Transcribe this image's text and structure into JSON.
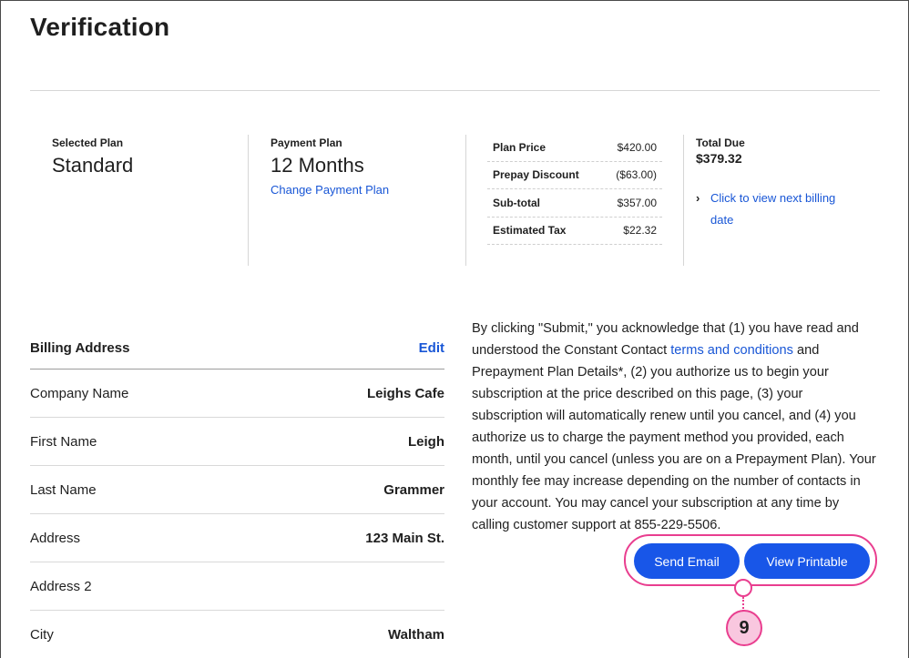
{
  "page": {
    "title": "Verification"
  },
  "summary": {
    "selected_plan": {
      "label": "Selected Plan",
      "value": "Standard"
    },
    "payment_plan": {
      "label": "Payment Plan",
      "value": "12 Months",
      "change_link": "Change Payment Plan"
    },
    "price_rows": [
      {
        "label": "Plan Price",
        "value": "$420.00"
      },
      {
        "label": "Prepay Discount",
        "value": "($63.00)"
      },
      {
        "label": "Sub-total",
        "value": "$357.00"
      },
      {
        "label": "Estimated Tax",
        "value": "$22.32"
      }
    ],
    "total_due": {
      "label": "Total Due",
      "value": "$379.32",
      "next_billing_link": "Click to view next billing date"
    }
  },
  "billing": {
    "header": {
      "label": "Billing Address",
      "edit": "Edit"
    },
    "rows": [
      {
        "label": "Company Name",
        "value": "Leighs Cafe"
      },
      {
        "label": "First Name",
        "value": "Leigh"
      },
      {
        "label": "Last Name",
        "value": "Grammer"
      },
      {
        "label": "Address",
        "value": "123 Main St."
      },
      {
        "label": "Address 2",
        "value": ""
      },
      {
        "label": "City",
        "value": "Waltham"
      }
    ]
  },
  "legal": {
    "part1": "By clicking \"Submit,\" you acknowledge that (1) you have read and understood the Constant Contact ",
    "terms_link": "terms and conditions",
    "part2": " and Prepayment Plan Details*, (2) you authorize us to begin your subscription at the price described on this page, (3) your subscription will automatically renew until you cancel, and (4) you authorize us to charge the payment method you provided, each month, until you cancel (unless you are on a Prepayment Plan). Your monthly fee may increase depending on the number of contacts in your account. You may cancel your subscription at any time by calling customer support at 855-229-5506."
  },
  "actions": {
    "send_email": "Send Email",
    "view_printable": "View Printable"
  },
  "callout": {
    "number": "9"
  },
  "colors": {
    "accent_blue": "#1856e8",
    "link_blue": "#1856d6",
    "callout_pink": "#e93e8f",
    "callout_fill": "#f9c7df"
  }
}
